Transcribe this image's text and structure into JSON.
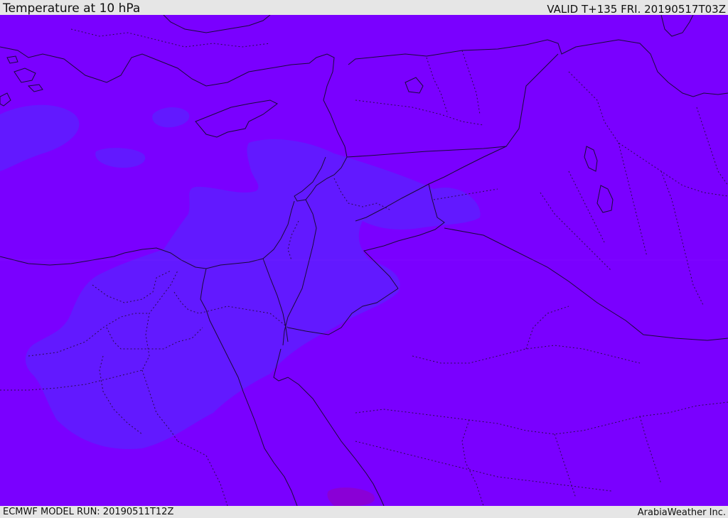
{
  "header": {
    "title": "Temperature at 10 hPa",
    "valid": "VALID T+135 FRI. 20190517T03Z"
  },
  "footer": {
    "model_run": "ECMWF MODEL RUN: 20190511T12Z",
    "credit": "ArabiaWeather Inc."
  },
  "colors": {
    "background_field": "#7a00ff",
    "warmer_field": "#6219ff",
    "warmest_spot": "#8a00d6",
    "coastline": "#1a0a3a",
    "borders": "#2a0a50"
  }
}
